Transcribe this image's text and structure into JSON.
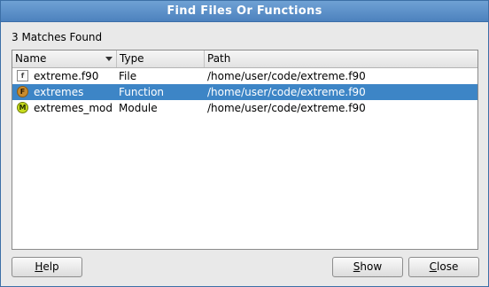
{
  "window": {
    "title": "Find Files Or Functions"
  },
  "status": {
    "matches_text": "3 Matches Found"
  },
  "table": {
    "columns": [
      "Name",
      "Type",
      "Path"
    ],
    "sort_column": "Name",
    "rows": [
      {
        "icon": "fortran-file-icon",
        "icon_glyph": "f",
        "name": "extreme.f90",
        "type": "File",
        "path": "/home/user/code/extreme.f90",
        "selected": false
      },
      {
        "icon": "function-icon",
        "icon_glyph": "F",
        "name": "extremes",
        "type": "Function",
        "path": "/home/user/code/extreme.f90",
        "selected": true
      },
      {
        "icon": "module-icon",
        "icon_glyph": "M",
        "name": "extremes_mod",
        "type": "Module",
        "path": "/home/user/code/extreme.f90",
        "selected": false
      }
    ]
  },
  "buttons": {
    "help_mnemonic": "H",
    "help_rest": "elp",
    "show_mnemonic": "S",
    "show_rest": "how",
    "close_mnemonic": "C",
    "close_rest": "lose"
  },
  "colors": {
    "selection": "#3d85c6",
    "titlebar": "#5b8fc8"
  }
}
